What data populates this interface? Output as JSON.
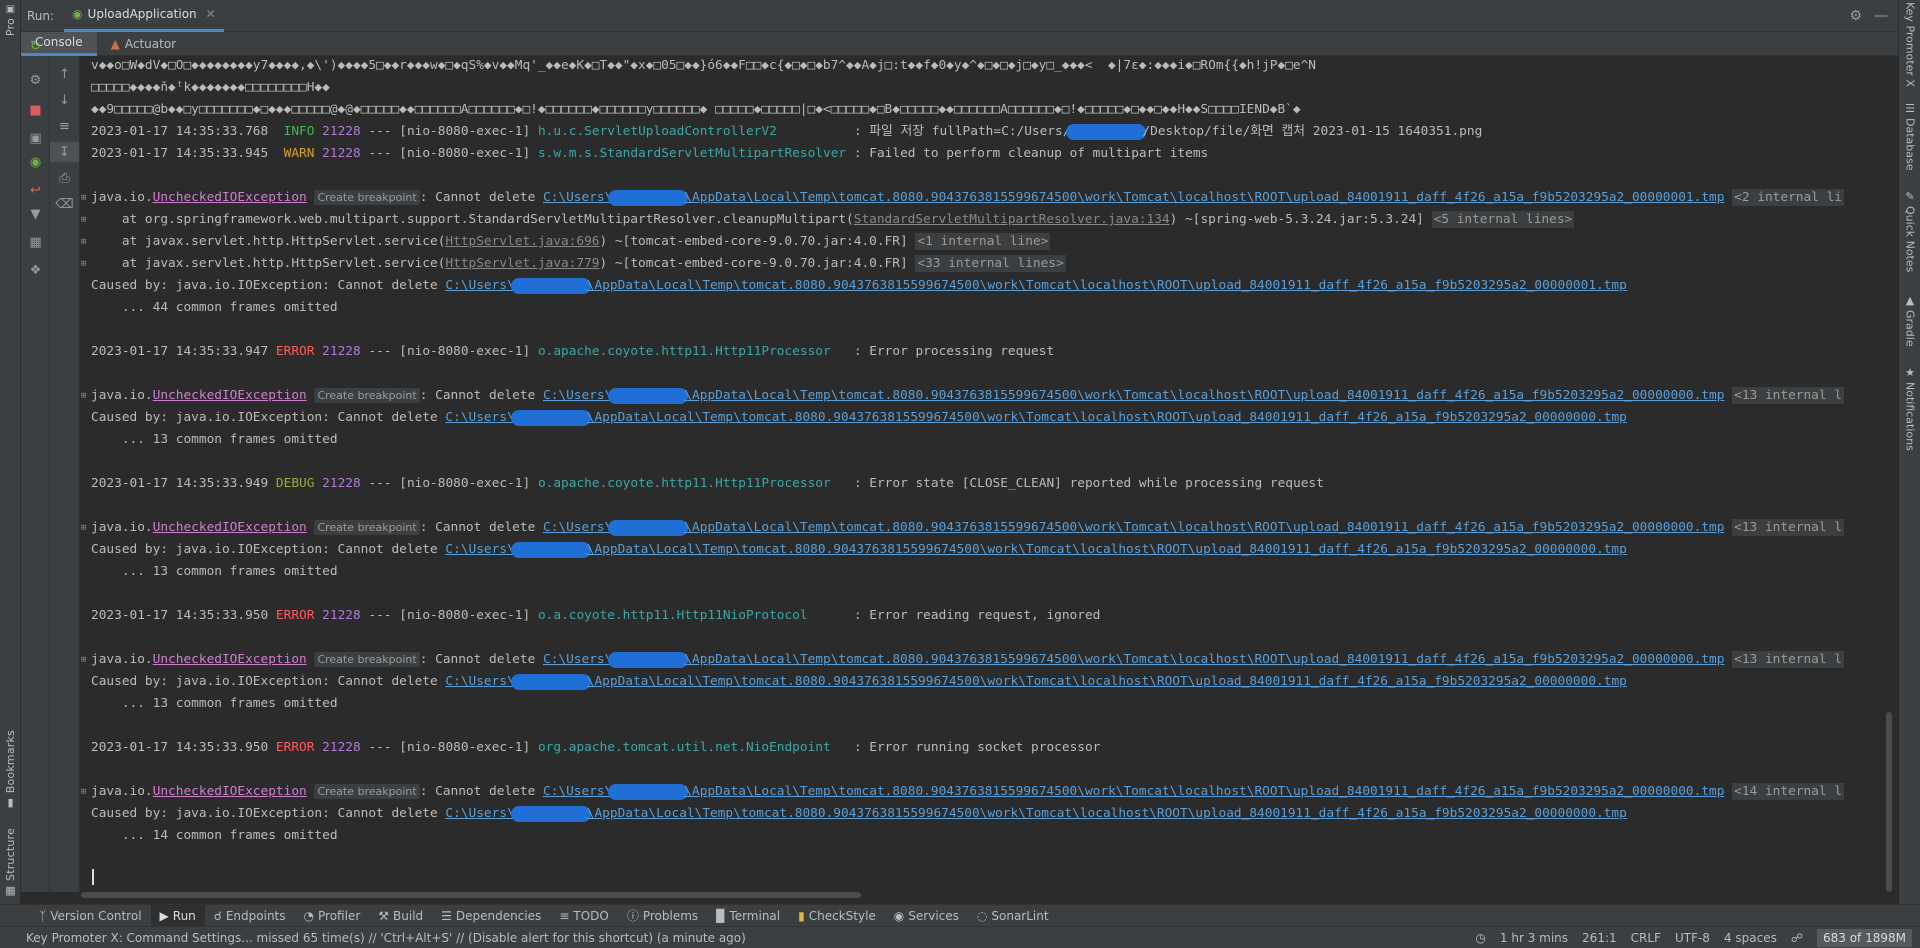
{
  "run": {
    "label": "Run:",
    "tab": "UploadApplication"
  },
  "subtabs": [
    "Console",
    "Actuator"
  ],
  "left_strip": {
    "project": "Pro",
    "bookmarks": "Bookmarks",
    "structure": "Structure"
  },
  "right_strip": {
    "key_promoter": "Key Promoter X",
    "database": "Database",
    "quick_notes": "Quick Notes",
    "gradle": "Gradle",
    "notifications": "Notifications"
  },
  "console": {
    "garbage1": "v◆◆o□W◆dV◆□O□◆◆◆◆◆◆◆◆y7◆◆◆◆,◆\\')◆◆◆◆5□◆◆r◆◆◆w◆□◆qS%◆v◆◆Mq'_◆◆e◆K◆□T◆◆\"◆x◆□05□◆◆}ó6◆◆F□□◆c{◆□◆□◆b7^◆◆A◆j□:t◆◆f◆0◆y◆^◆□◆□◆j□◆y□_◆◆◆<  ◆|7ɛ◆:◆◆◆i◆□ROm{{◆h!jP◆□e^N",
    "garbage2": "□□□□□◆◆◆◆ň◆ᵗk◆◆◆◆◆◆◆□□□□□□□□H◆◆",
    "garbage3": "◆◆9□□□□□@b◆◆□y□□□□□□□◆□◆◆◆□□□□□@◆@◆□□□□□◆◆□□□□□□A□□□□□□◆□!◆□□□□□□◆□□□□□□y□□□□□□◆ □□□□□◆□□□□□|□◆<□□□□□◆□B◆□□□□□◆◆□□□□□□A□□□□□□◆□!◆□□□□□◆□◆◆□◆◆H◆◆S□□□□IEND◆B`◆",
    "log1": {
      "ts": "2023-01-17 14:35:33.768",
      "level": "INFO",
      "pid": "21228",
      "thread": "--- [nio-8080-exec-1]",
      "logger": "h.u.c.ServletUploadControllerV2",
      "msg_pre": ": 파일 저장 fullPath=C:/Users/",
      "msg_post": "/Desktop/file/화면 캡처 2023-01-15 1640351.png"
    },
    "log2": {
      "ts": "2023-01-17 14:35:33.945",
      "level": "WARN",
      "pid": "21228",
      "thread": "--- [nio-8080-exec-1]",
      "logger": "s.w.m.s.StandardServletMultipartResolver",
      "msg": ": Failed to perform cleanup of multipart items"
    },
    "exc_prefix": "java.io.",
    "exc_class": "UncheckedIOException",
    "create_bp": "Create breakpoint",
    "cannot_delete": ": Cannot delete ",
    "path_start": "C:\\Users\\",
    "path_rest1": "\\AppData\\Local\\Temp\\tomcat.8080.9043763815599674500\\work\\Tomcat\\localhost\\ROOT\\upload_84001911_daff_4f26_a15a_f9b5203295a2_00000001.tmp",
    "path_rest0": "\\AppData\\Local\\Temp\\tomcat.8080.9043763815599674500\\work\\Tomcat\\localhost\\ROOT\\upload_84001911_daff_4f26_a15a_f9b5203295a2_00000000.tmp",
    "internal_2": "<2 internal li",
    "internal_13": "<13 internal l",
    "internal_14": "<14 internal l",
    "at1_pre": "    at org.springframework.web.multipart.support.StandardServletMultipartResolver.cleanupMultipart(",
    "at1_link": "StandardServletMultipartResolver.java:134",
    "at1_post": ") ~[spring-web-5.3.24.jar:5.3.24] ",
    "at1_internal": "<5 internal lines>",
    "at2_pre": "    at javax.servlet.http.HttpServlet.service(",
    "at2_link": "HttpServlet.java:696",
    "at2_post": ") ~[tomcat-embed-core-9.0.70.jar:4.0.FR] ",
    "at2_internal": "<1 internal line>",
    "at3_link": "HttpServlet.java:779",
    "at3_internal": "<33 internal lines>",
    "caused_by": "Caused by: java.io.IOException: Cannot delete ",
    "omitted44": "    ... 44 common frames omitted",
    "omitted13": "    ... 13 common frames omitted",
    "omitted14": "    ... 14 common frames omitted",
    "log3": {
      "ts": "2023-01-17 14:35:33.947",
      "level": "ERROR",
      "pid": "21228",
      "thread": "--- [nio-8080-exec-1]",
      "logger": "o.apache.coyote.http11.Http11Processor",
      "msg": ": Error processing request"
    },
    "log4": {
      "ts": "2023-01-17 14:35:33.949",
      "level": "DEBUG",
      "pid": "21228",
      "thread": "--- [nio-8080-exec-1]",
      "logger": "o.apache.coyote.http11.Http11Processor",
      "msg": ": Error state [CLOSE_CLEAN] reported while processing request"
    },
    "log5": {
      "ts": "2023-01-17 14:35:33.950",
      "level": "ERROR",
      "pid": "21228",
      "thread": "--- [nio-8080-exec-1]",
      "logger": "o.a.coyote.http11.Http11NioProtocol",
      "msg": ": Error reading request, ignored"
    },
    "log6": {
      "ts": "2023-01-17 14:35:33.950",
      "level": "ERROR",
      "pid": "21228",
      "thread": "--- [nio-8080-exec-1]",
      "logger": "org.apache.tomcat.util.net.NioEndpoint",
      "msg": ": Error running socket processor"
    }
  },
  "bottom_tabs": [
    "Version Control",
    "Run",
    "Endpoints",
    "Profiler",
    "Build",
    "Dependencies",
    "TODO",
    "Problems",
    "Terminal",
    "CheckStyle",
    "Services",
    "SonarLint"
  ],
  "status": {
    "message": "Key Promoter X: Command Settings... missed 65 time(s) // 'Ctrl+Alt+S' // (Disable alert for this shortcut) (a minute ago)",
    "time": "1 hr 3 mins",
    "position": "261:1",
    "line_sep": "CRLF",
    "encoding": "UTF-8",
    "indent": "4 spaces",
    "memory": "683 of 1898M"
  },
  "colors": {
    "info": "#3fb950",
    "warn": "#d6a12b",
    "error": "#ff5c5c",
    "debug": "#9aad3a",
    "link": "#5a9fd8",
    "redaction": "#1f6fd6"
  }
}
